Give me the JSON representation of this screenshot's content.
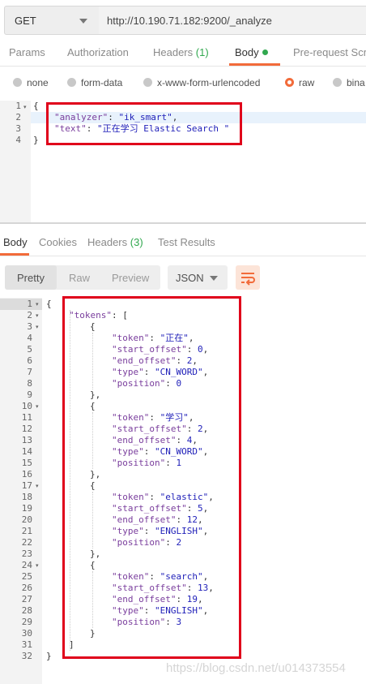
{
  "request": {
    "method": "GET",
    "url": "http://10.190.71.182:9200/_analyze",
    "tabs": [
      {
        "label": "Params"
      },
      {
        "label": "Authorization"
      },
      {
        "label": "Headers",
        "count": "(1)"
      },
      {
        "label": "Body"
      },
      {
        "label": "Pre-request Scrip"
      }
    ],
    "body_types": [
      "none",
      "form-data",
      "x-www-form-urlencoded",
      "raw",
      "bina"
    ],
    "selected_body_type": "raw",
    "editor_lines": [
      {
        "n": "1",
        "text": "{"
      },
      {
        "n": "2",
        "key": "\"analyzer\"",
        "value": "\"ik_smart\"",
        "tail": ","
      },
      {
        "n": "3",
        "key": "\"text\"",
        "value": "\"正在学习 Elastic Search \""
      },
      {
        "n": "4",
        "text": "}"
      }
    ]
  },
  "response": {
    "tabs": [
      {
        "label": "Body"
      },
      {
        "label": "Cookies"
      },
      {
        "label": "Headers",
        "count": "(3)"
      },
      {
        "label": "Test Results"
      }
    ],
    "format_buttons": [
      "Pretty",
      "Raw",
      "Preview"
    ],
    "format_select": "JSON",
    "lines": [
      "1",
      "2",
      "3",
      "4",
      "5",
      "6",
      "7",
      "8",
      "9",
      "10",
      "11",
      "12",
      "13",
      "14",
      "15",
      "16",
      "17",
      "18",
      "19",
      "20",
      "21",
      "22",
      "23",
      "24",
      "25",
      "26",
      "27",
      "28",
      "29",
      "30",
      "31",
      "32"
    ],
    "json": {
      "tokens_key": "\"tokens\"",
      "tokens": [
        {
          "token": "\"正在\"",
          "start_offset": "0",
          "end_offset": "2",
          "type": "\"CN_WORD\"",
          "position": "0"
        },
        {
          "token": "\"学习\"",
          "start_offset": "2",
          "end_offset": "4",
          "type": "\"CN_WORD\"",
          "position": "1"
        },
        {
          "token": "\"elastic\"",
          "start_offset": "5",
          "end_offset": "12",
          "type": "\"ENGLISH\"",
          "position": "2"
        },
        {
          "token": "\"search\"",
          "start_offset": "13",
          "end_offset": "19",
          "type": "\"ENGLISH\"",
          "position": "3"
        }
      ],
      "field_keys": [
        "\"token\"",
        "\"start_offset\"",
        "\"end_offset\"",
        "\"type\"",
        "\"position\""
      ]
    }
  },
  "watermark": "https://blog.csdn.net/u014373554",
  "colors": {
    "accent": "#f26b3a",
    "green": "#31a84f",
    "highlight_box": "#e0001b"
  }
}
